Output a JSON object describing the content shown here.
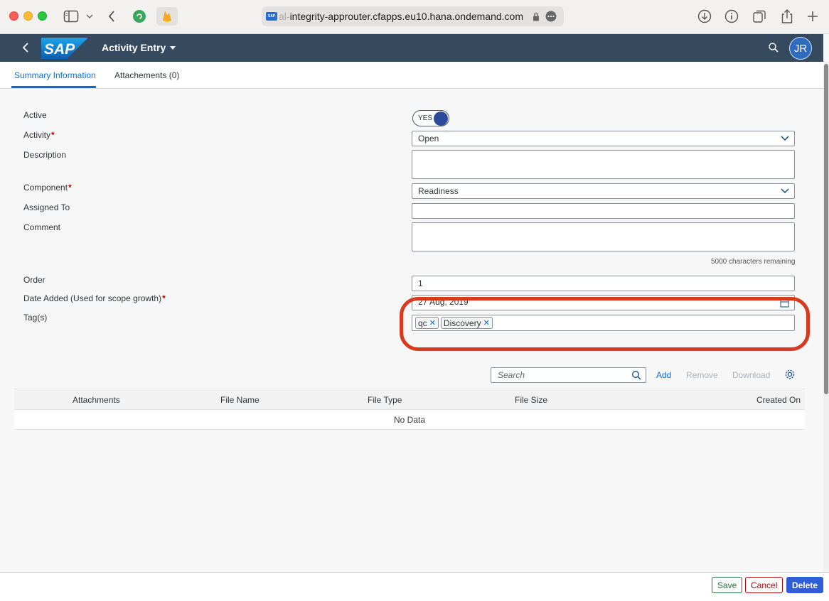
{
  "browser": {
    "url_faded": "al-",
    "url_main": "integrity-approuter.cfapps.eu10.hana.ondemand.com"
  },
  "shell": {
    "logo": "SAP",
    "title": "Activity Entry",
    "avatar_initials": "JR"
  },
  "tabs": [
    {
      "label": "Summary Information"
    },
    {
      "label": "Attachements (0)"
    }
  ],
  "form": {
    "active_label": "Active",
    "active_value": "YES",
    "activity_label": "Activity",
    "activity_value": "Open",
    "description_label": "Description",
    "description_value": "",
    "component_label": "Component",
    "component_value": "Readiness",
    "assigned_label": "Assigned To",
    "assigned_value": "",
    "comment_label": "Comment",
    "comment_value": "",
    "chars_remaining": "5000 characters remaining",
    "order_label": "Order",
    "order_value": "1",
    "date_label": "Date Added (Used for scope growth)",
    "date_value": "27 Aug, 2019",
    "tags_label": "Tag(s)",
    "tags": [
      "qc",
      "Discovery"
    ],
    "required_mark": "*"
  },
  "attachments": {
    "search_placeholder": "Search",
    "add_label": "Add",
    "remove_label": "Remove",
    "download_label": "Download",
    "columns": [
      "Attachments",
      "File Name",
      "File Type",
      "File Size",
      "Created On"
    ],
    "no_data": "No Data"
  },
  "footer": {
    "save": "Save",
    "cancel": "Cancel",
    "delete": "Delete"
  },
  "colors": {
    "shell": "#354a5f",
    "accent": "#0a6ed1",
    "highlight": "#d9391e"
  }
}
